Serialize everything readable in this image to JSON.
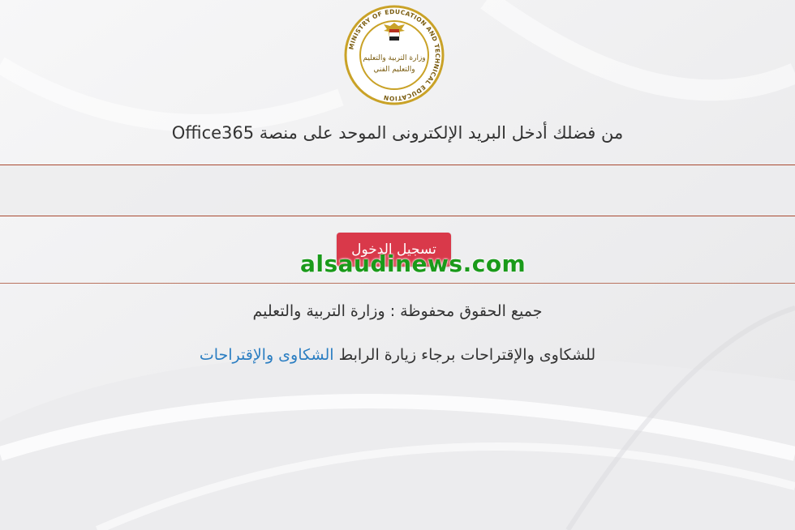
{
  "header": {
    "prompt_text": "من فضلك أدخل البريد الإلكترونى الموحد على منصة Office365"
  },
  "form": {
    "email_value": "",
    "login_label": "تسجيل الدخول"
  },
  "watermark": {
    "text": "alsaudinews.com",
    "color": "#1a9a1a"
  },
  "footer": {
    "copyright": "جميع الحقوق محفوظة : وزارة التربية والتعليم",
    "complaints_prefix": "للشكاوى والإقتراحات برجاء زيارة الرابط ",
    "complaints_link": "الشكاوى والإقتراحات"
  },
  "seal": {
    "inner_text_top": "وزارة التربية والتعليم",
    "inner_text_bottom": "والتعليم الفني",
    "ring_text": "MINISTRY OF EDUCATION AND TECHNICAL EDUCATION",
    "emblem": "eagle-icon"
  },
  "colors": {
    "button": "#d9394a",
    "link": "#2b7ec2",
    "border": "#a94a32",
    "seal_gold": "#c9a227"
  }
}
